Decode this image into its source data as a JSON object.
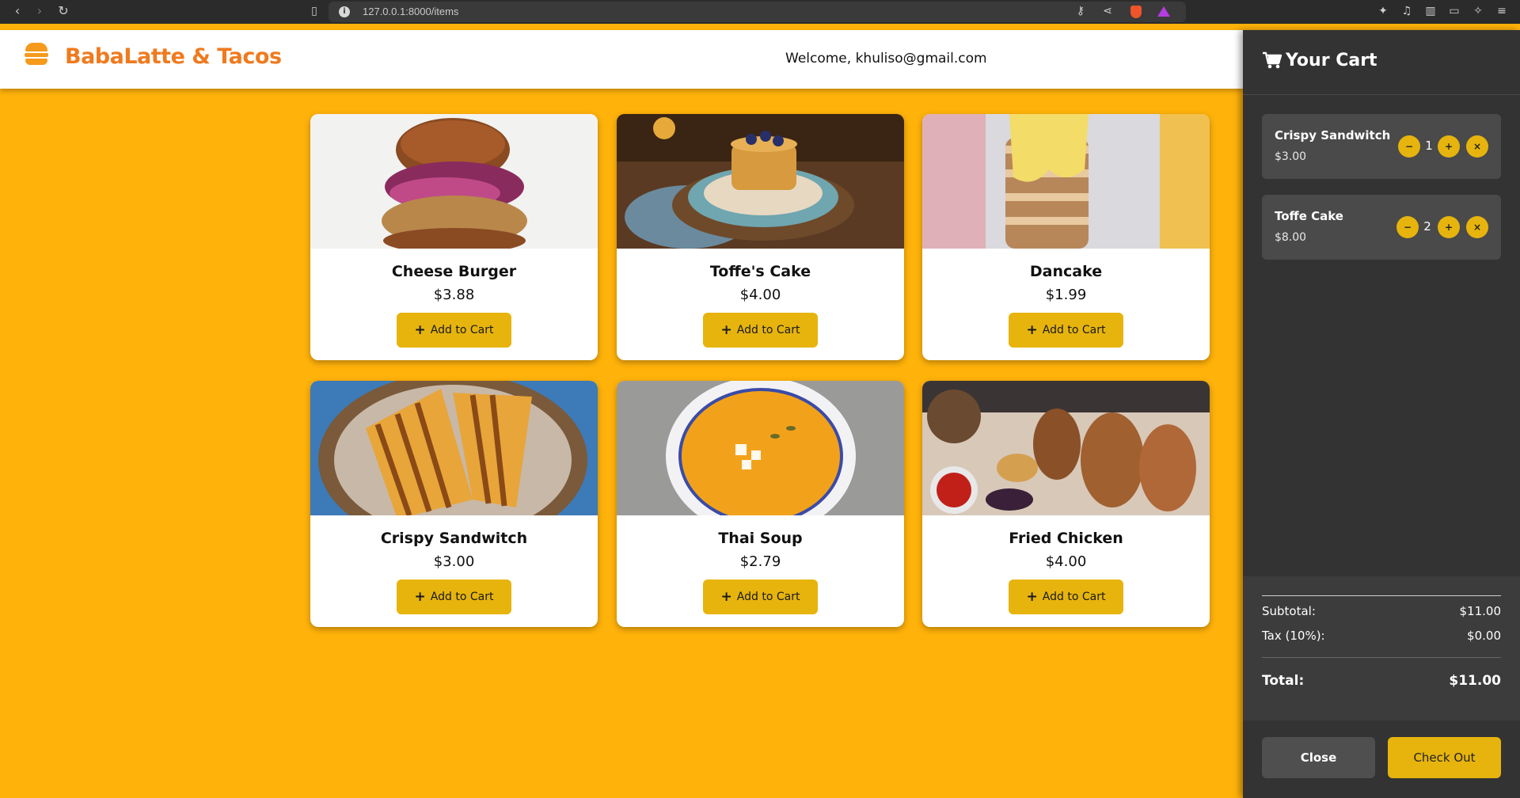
{
  "browser": {
    "url": "127.0.0.1:8000/items"
  },
  "header": {
    "brand": "BabaLatte & Tacos",
    "welcome": "Welcome, khuliso@gmail.com"
  },
  "products": [
    {
      "name": "Cheese Burger",
      "price": "$3.88",
      "button": "Add to Cart"
    },
    {
      "name": "Toffe's Cake",
      "price": "$4.00",
      "button": "Add to Cart"
    },
    {
      "name": "Dancake",
      "price": "$1.99",
      "button": "Add to Cart"
    },
    {
      "name": "Crispy Sandwitch",
      "price": "$3.00",
      "button": "Add to Cart"
    },
    {
      "name": "Thai Soup",
      "price": "$2.79",
      "button": "Add to Cart"
    },
    {
      "name": "Fried Chicken",
      "price": "$4.00",
      "button": "Add to Cart"
    }
  ],
  "cart": {
    "title": "Your Cart",
    "items": [
      {
        "name": "Crispy Sandwitch",
        "price": "$3.00",
        "qty": "1",
        "minus": "−",
        "plus": "+",
        "remove": "×"
      },
      {
        "name": "Toffe Cake",
        "price": "$8.00",
        "qty": "2",
        "minus": "−",
        "plus": "+",
        "remove": "×"
      }
    ],
    "subtotal_label": "Subtotal:",
    "subtotal": "$11.00",
    "tax_label": "Tax (10%):",
    "tax": "$0.00",
    "total_label": "Total:",
    "total": "$11.00",
    "close": "Close",
    "checkout": "Check Out"
  },
  "colors": {
    "page_bg": "#ffb20a",
    "accent": "#e6b40d",
    "brand": "#ef7a1f",
    "cart_bg": "#333333"
  }
}
